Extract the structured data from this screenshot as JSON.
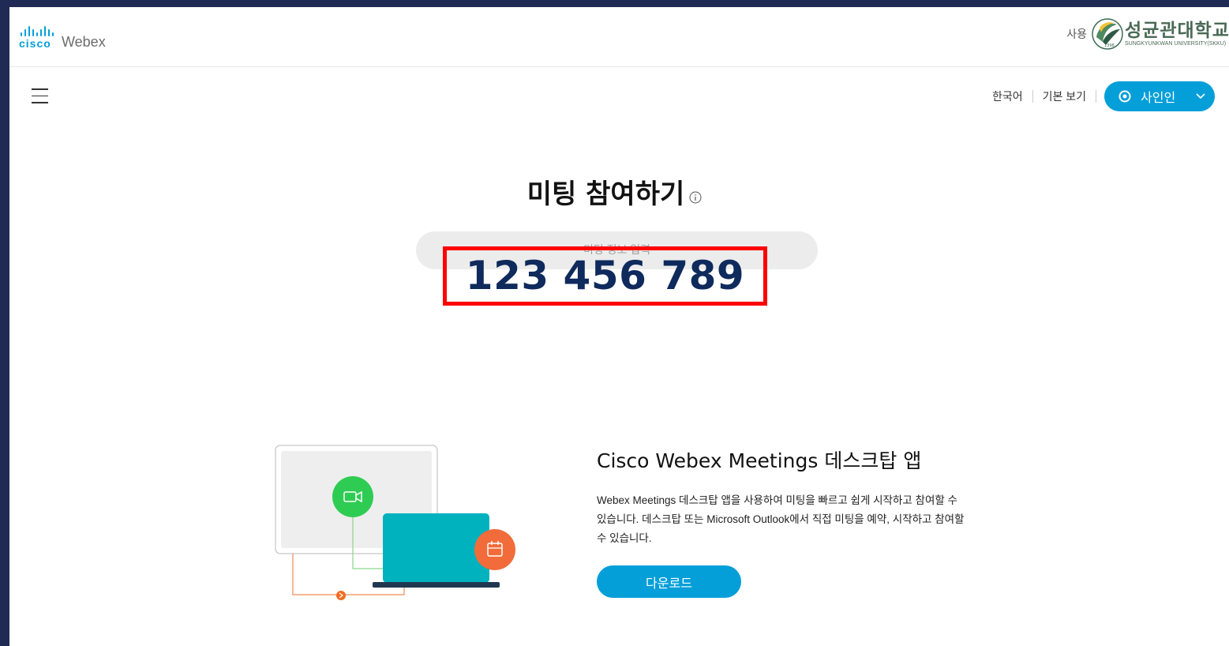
{
  "header": {
    "brand_cisco": "cisco",
    "brand_webex": "Webex",
    "sponsor_label": "사용",
    "university_name_ko": "성균관대학교",
    "university_name_en": "SUNGKYUNKWAN UNIVERSITY(SKKU)"
  },
  "nav": {
    "language": "한국어",
    "view_mode": "기본 보기",
    "signin_label": "사인인"
  },
  "join": {
    "title": "미팅 참여하기",
    "placeholder": "미팅 정보 입력",
    "entered_number": "123 456 789"
  },
  "promo": {
    "title": "Cisco Webex Meetings 데스크탑 앱",
    "description": "Webex Meetings 데스크탑 앱을 사용하여 미팅을 빠르고 쉽게 시작하고 참여할 수 있습니다. 데스크탑 또는 Microsoft Outlook에서 직접 미팅을 예약, 시작하고 참여할 수 있습니다.",
    "download_label": "다운로드"
  },
  "colors": {
    "accent": "#049fd9",
    "highlight": "#ff0000",
    "number_text": "#0f2a5c",
    "frame": "#1f2a55"
  }
}
